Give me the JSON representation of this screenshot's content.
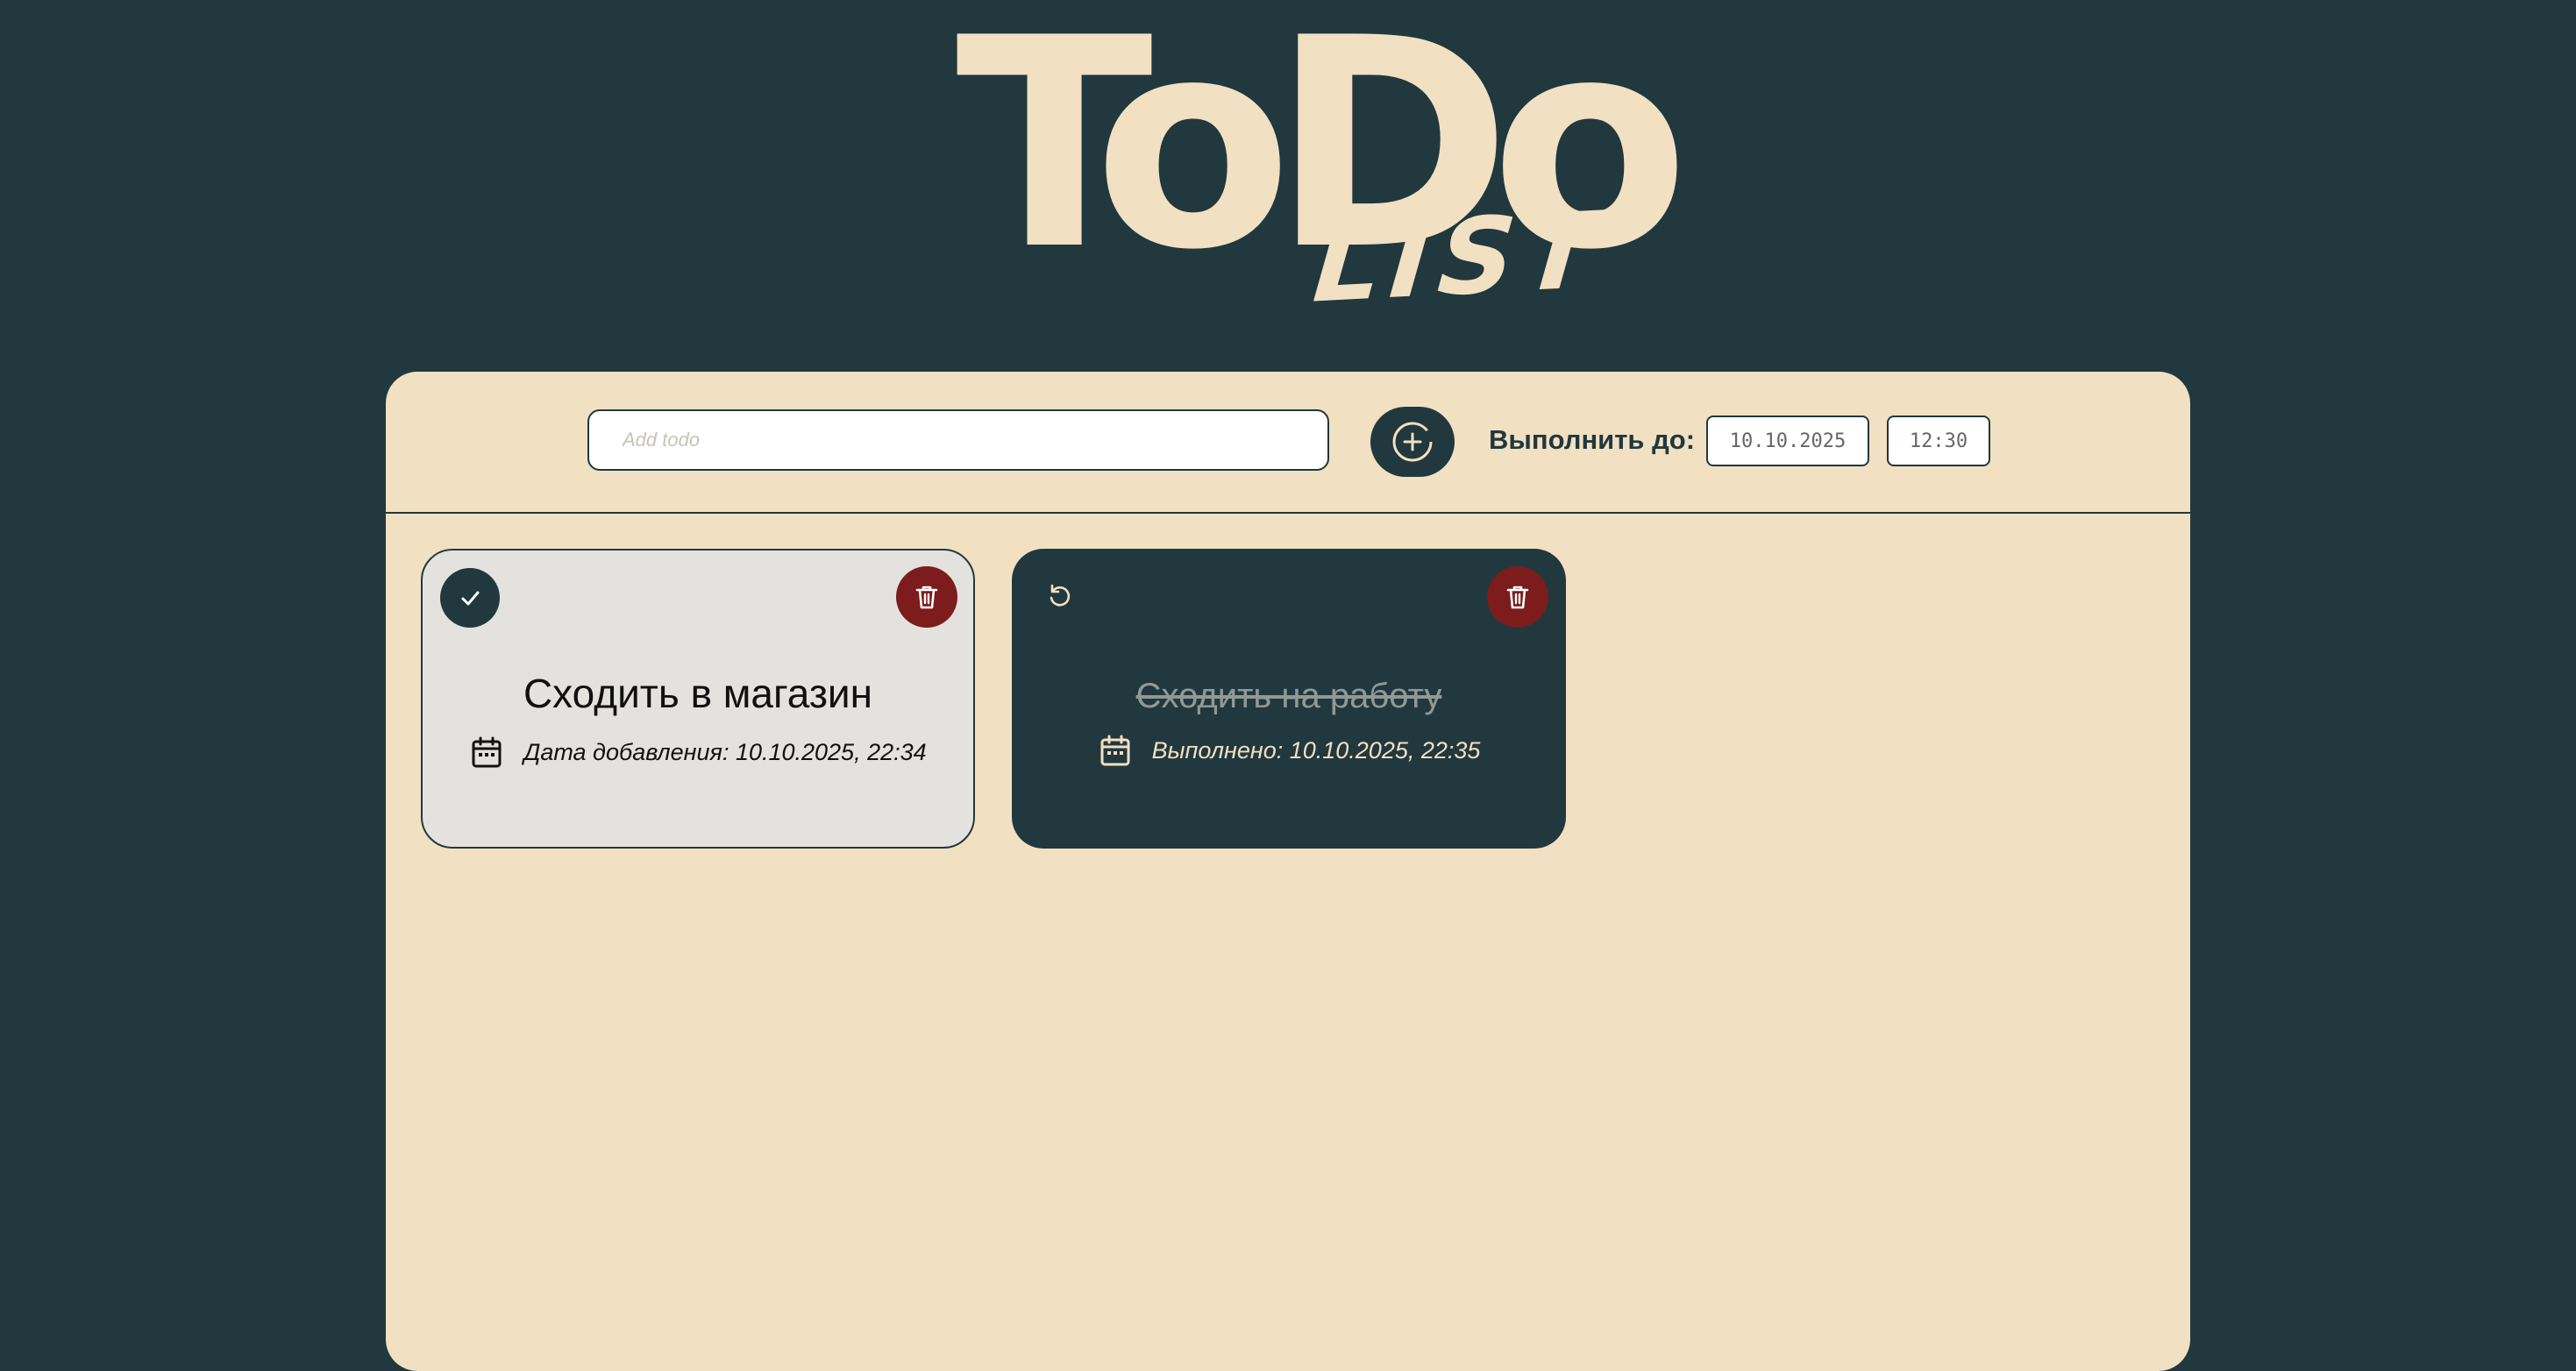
{
  "header": {
    "logo_main": "ToDo",
    "logo_sub": "LIST"
  },
  "toolbar": {
    "input_placeholder": "Add todo",
    "input_value": "",
    "add_button_icon": "plus-circle-icon",
    "deadline_label": "Выполнить до:",
    "deadline_date": "10.10.2025",
    "deadline_time": "12:30"
  },
  "todos": [
    {
      "title": "Сходить в магазин",
      "status": "active",
      "meta": "Дата добавления: 10.10.2025, 22:34",
      "action_icon": "check-icon",
      "delete_icon": "trash-icon"
    },
    {
      "title": "Сходить на работу",
      "status": "done",
      "meta": "Выполнено: 10.10.2025, 22:35",
      "action_icon": "undo-icon",
      "delete_icon": "trash-icon"
    }
  ],
  "colors": {
    "background": "#21383e",
    "panel": "#f2e0c2",
    "active_card": "#e4e2df",
    "done_card": "#21383e",
    "delete": "#7c1c1c"
  }
}
